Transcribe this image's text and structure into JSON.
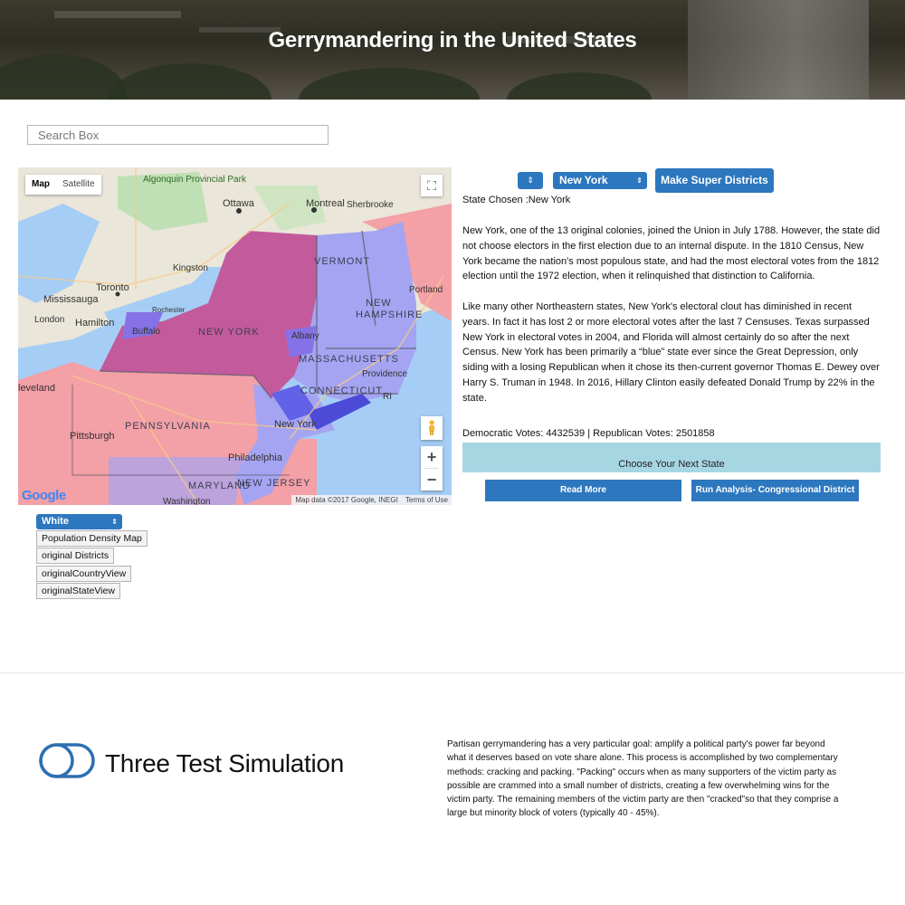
{
  "header": {
    "title": "Gerrymandering in the United States"
  },
  "search": {
    "placeholder": "Search Box"
  },
  "map": {
    "type_map": "Map",
    "type_satellite": "Satellite",
    "google": "Google",
    "attribution": "Map data ©2017 Google, INEGI",
    "terms": "Terms of Use",
    "labels": {
      "algonquin": "Algonquin Provincial Park",
      "ottawa": "Ottawa",
      "montreal": "Montreal",
      "sherbrooke": "Sherbrooke",
      "kingston": "Kingston",
      "toronto": "Toronto",
      "mississauga": "Mississauga",
      "hamilton": "Hamilton",
      "london": "London",
      "rochester": "Rochester",
      "buffalo": "Buffalo",
      "albany": "Albany",
      "portland": "Portland",
      "cleveland": "leveland",
      "pittsburgh": "Pittsburgh",
      "philadelphia": "Philadelphia",
      "providence": "Providence",
      "new_york_city": "New York",
      "washington": "Washington",
      "ri": "RI",
      "vermont": "VERMONT",
      "new_hampshire_1": "NEW",
      "new_hampshire_2": "HAMPSHIRE",
      "new_york": "NEW YORK",
      "massachusetts": "MASSACHUSETTS",
      "connecticut": "CONNECTICUT",
      "pennsylvania": "PENNSYLVANIA",
      "maryland": "MARYLAND",
      "new_jersey": "NEW JERSEY"
    },
    "colors": {
      "republican": "#f39ba3",
      "democrat": "#9a9af0",
      "overlap": "#c0599a",
      "water": "#a6cdf5"
    }
  },
  "controls": {
    "blank_select": "",
    "state_select": "New York",
    "super_districts": "Make Super Districts",
    "state_chosen": "State Chosen :New York",
    "description": [
      "New York, one of the 13 original colonies, joined the Union in July 1788. However, the state did not choose electors in the first election due to an internal dispute. In the 1810 Census, New York became the nation's most populous state, and had the most electoral votes from the 1812 election until the 1972 election, when it relinquished that distinction to California.",
      "Like many other Northeastern states, New York's electoral clout has diminished in recent years. In fact it has lost 2 or more electoral votes after the last 7 Censuses. Texas surpassed New York in electoral votes in 2004, and Florida will almost certainly do so after the next Census. New York has been primarily a “blue” state ever since the Great Depression, only siding with a losing Republican when it chose its then-current governor Thomas E. Dewey over Harry S. Truman in 1948. In 2016, Hillary Clinton easily defeated Donald Trump by 22% in the state."
    ],
    "votes": "Democratic Votes: 4432539 | Republican Votes: 2501858",
    "next_state": "Choose Your Next State",
    "read_more": "Read  More",
    "run_analysis": "Run Analysis- Congressional District"
  },
  "view": {
    "select": "White",
    "buttons": [
      "Population Density Map",
      "original Districts",
      "originalCountryView",
      "originalStateView"
    ]
  },
  "footer": {
    "brand": "Three Test Simulation",
    "text": "Partisan gerrymandering has a very particular goal: amplify a political party's power far beyond what it deserves based on vote share alone. This process is accomplished by two complementary methods: cracking and packing. \"Packing\" occurs when as many supporters of the victim party as possible are crammed into a small number of districts, creating a few overwhelming wins for the victim party. The remaining members of the victim party are then \"cracked\"so that they comprise a large but minority block of voters (typically 40 - 45%)."
  }
}
